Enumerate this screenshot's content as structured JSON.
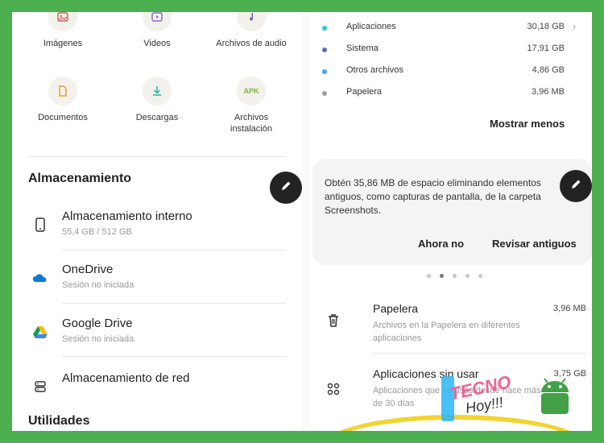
{
  "categories": [
    {
      "label": "Imágenes",
      "icon": "image-icon"
    },
    {
      "label": "Videos",
      "icon": "video-icon"
    },
    {
      "label": "Archivos de audio",
      "icon": "audio-icon"
    },
    {
      "label": "Documentos",
      "icon": "document-icon"
    },
    {
      "label": "Descargas",
      "icon": "download-icon"
    },
    {
      "label_line1": "Archivos",
      "label_line2": "instalación",
      "badge": "APK",
      "icon": "apk-icon"
    }
  ],
  "storage": {
    "title": "Almacenamiento",
    "items": [
      {
        "name": "Almacenamiento interno",
        "sub": "55,4 GB / 512 GB"
      },
      {
        "name": "OneDrive",
        "sub": "Sesión no iniciada"
      },
      {
        "name": "Google Drive",
        "sub": "Sesión no iniciada"
      },
      {
        "name": "Almacenamiento de red",
        "sub": ""
      }
    ]
  },
  "utilities_title": "Utilidades",
  "usage": [
    {
      "label": "Aplicaciones",
      "value": "30,18 GB",
      "color": "#26c6da",
      "chevron": "›"
    },
    {
      "label": "Sistema",
      "value": "17,91 GB",
      "color": "#5c6bc0"
    },
    {
      "label": "Otros archivos",
      "value": "4,86 GB",
      "color": "#42a5f5"
    },
    {
      "label": "Papelera",
      "value": "3,96 MB",
      "color": "#9e9e9e"
    }
  ],
  "show_less": "Mostrar menos",
  "card": {
    "message": "Obtén 35,86 MB de espacio eliminando elementos antiguos, como capturas de pantalla, de la carpeta Screenshots.",
    "btn_not_now": "Ahora no",
    "btn_review": "Revisar antiguos"
  },
  "tools": [
    {
      "name": "Papelera",
      "size": "3,96 MB",
      "desc": "Archivos en la Papelera en diferentes aplicaciones"
    },
    {
      "name": "Aplicaciones sin usar",
      "size": "3,75 GB",
      "desc": "Aplicaciones que no usas desde hace más de 30 días"
    }
  ],
  "watermark": {
    "line1": "TECNO",
    "line2": "Hoy!!!"
  },
  "colors": {
    "accent_green": "#4caf50",
    "highlight": "#f2d433",
    "fab": "#222222"
  }
}
